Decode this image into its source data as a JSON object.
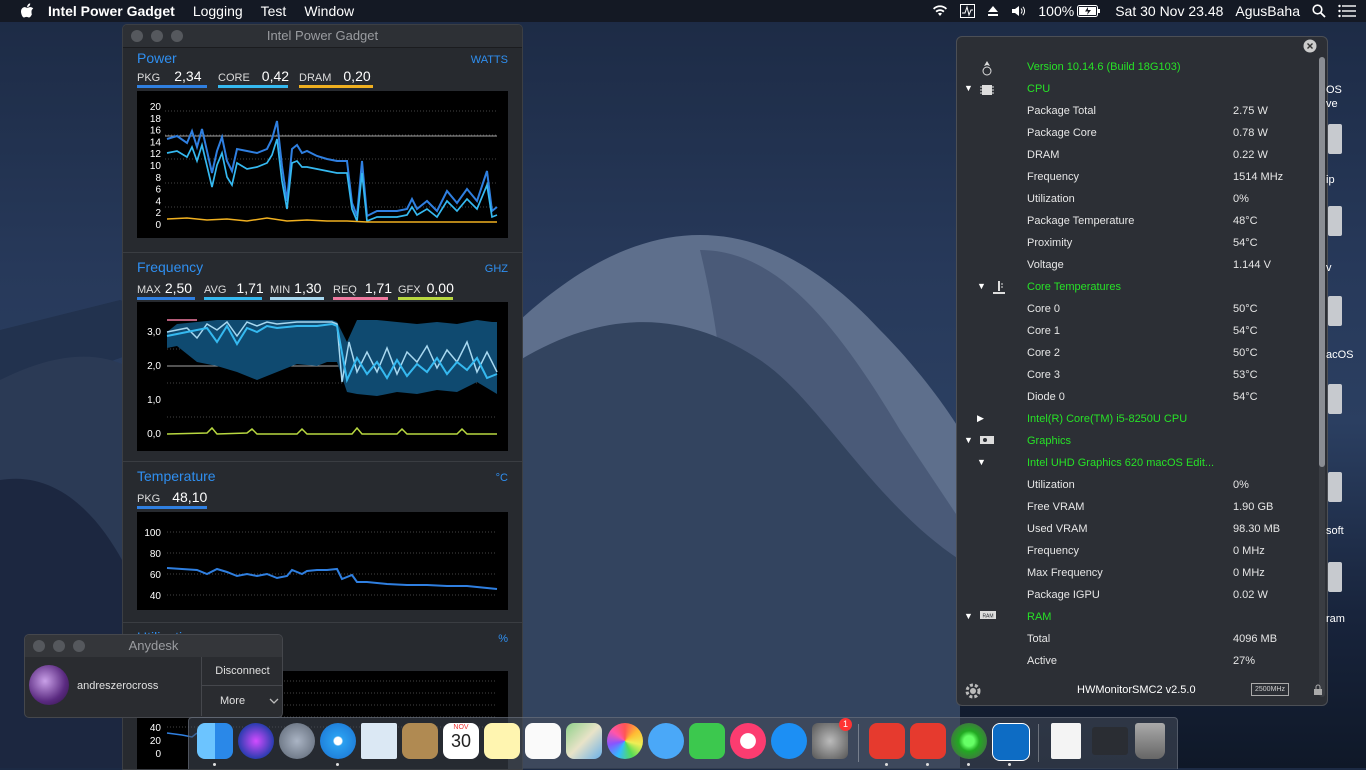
{
  "menubar": {
    "app_name": "Intel Power Gadget",
    "menus": [
      "Logging",
      "Test",
      "Window"
    ],
    "battery": "100%",
    "datetime": "Sat 30 Nov  23.48",
    "user": "AgusBaha"
  },
  "ipg": {
    "window_title": "Intel Power Gadget",
    "power": {
      "title": "Power",
      "unit": "WATTS",
      "metrics": [
        {
          "label": "PKG",
          "value": "2,34",
          "color": "#2f7fe0"
        },
        {
          "label": "CORE",
          "value": "0,42",
          "color": "#35b9f0"
        },
        {
          "label": "DRAM",
          "value": "0,20",
          "color": "#f0b020"
        }
      ],
      "yticks": [
        "20",
        "18",
        "16",
        "14",
        "12",
        "10",
        "8",
        "6",
        "4",
        "2",
        "0"
      ]
    },
    "frequency": {
      "title": "Frequency",
      "unit": "GHZ",
      "metrics": [
        {
          "label": "MAX",
          "value": "2,50",
          "color": "#2f7fe0"
        },
        {
          "label": "AVG",
          "value": "1,71",
          "color": "#35b9f0"
        },
        {
          "label": "MIN",
          "value": "1,30",
          "color": "#a8d8f0"
        },
        {
          "label": "REQ",
          "value": "1,71",
          "color": "#f07aa0"
        },
        {
          "label": "GFX",
          "value": "0,00",
          "color": "#b8d840"
        }
      ],
      "yticks": [
        "3,0",
        "2,0",
        "1,0",
        "0,0"
      ]
    },
    "temperature": {
      "title": "Temperature",
      "unit": "°C",
      "metrics": [
        {
          "label": "PKG",
          "value": "48,10",
          "color": "#2f7fe0"
        }
      ],
      "yticks": [
        "100",
        "80",
        "60",
        "40"
      ]
    },
    "utilization": {
      "title": "Utilization",
      "unit": "%",
      "yticks": [
        "40",
        "20",
        "0"
      ]
    }
  },
  "anydesk": {
    "title": "Anydesk",
    "username": "andreszerocross",
    "disconnect_label": "Disconnect",
    "more_label": "More"
  },
  "hwm": {
    "version": "Version 10.14.6 (Build 18G103)",
    "rows": [
      {
        "arrow": "▼",
        "icon": "cpu-icon",
        "label": "CPU",
        "value": "",
        "green": true
      },
      {
        "arrow": "",
        "icon": "",
        "label": "Package Total",
        "value": "2.75 W",
        "green": false
      },
      {
        "arrow": "",
        "icon": "",
        "label": "Package Core",
        "value": "0.78 W",
        "green": false
      },
      {
        "arrow": "",
        "icon": "",
        "label": "DRAM",
        "value": "0.22 W",
        "green": false
      },
      {
        "arrow": "",
        "icon": "",
        "label": "Frequency",
        "value": "1514 MHz",
        "green": false
      },
      {
        "arrow": "",
        "icon": "",
        "label": "Utilization",
        "value": "0%",
        "green": false
      },
      {
        "arrow": "",
        "icon": "",
        "label": "Package Temperature",
        "value": "48°C",
        "green": false
      },
      {
        "arrow": "",
        "icon": "",
        "label": "Proximity",
        "value": "54°C",
        "green": false
      },
      {
        "arrow": "",
        "icon": "",
        "label": "Voltage",
        "value": "1.144 V",
        "green": false
      },
      {
        "arrow": "▼",
        "icon": "thermometer-icon",
        "label": "Core Temperatures",
        "value": "",
        "green": true,
        "indent": true
      },
      {
        "arrow": "",
        "icon": "",
        "label": "Core 0",
        "value": "50°C",
        "green": false
      },
      {
        "arrow": "",
        "icon": "",
        "label": "Core 1",
        "value": "54°C",
        "green": false
      },
      {
        "arrow": "",
        "icon": "",
        "label": "Core 2",
        "value": "50°C",
        "green": false
      },
      {
        "arrow": "",
        "icon": "",
        "label": "Core 3",
        "value": "53°C",
        "green": false
      },
      {
        "arrow": "",
        "icon": "",
        "label": "Diode 0",
        "value": "54°C",
        "green": false
      },
      {
        "arrow": "▶",
        "icon": "",
        "label": "Intel(R) Core(TM) i5-8250U CPU",
        "value": "",
        "green": true,
        "indent": true
      },
      {
        "arrow": "▼",
        "icon": "gpu-icon",
        "label": "Graphics",
        "value": "",
        "green": true
      },
      {
        "arrow": "▼",
        "icon": "",
        "label": "Intel UHD Graphics 620 macOS Edit...",
        "value": "",
        "green": true,
        "indent": true
      },
      {
        "arrow": "",
        "icon": "",
        "label": "Utilization",
        "value": "0%",
        "green": false
      },
      {
        "arrow": "",
        "icon": "",
        "label": "Free VRAM",
        "value": "1.90 GB",
        "green": false
      },
      {
        "arrow": "",
        "icon": "",
        "label": "Used VRAM",
        "value": "98.30 MB",
        "green": false
      },
      {
        "arrow": "",
        "icon": "",
        "label": "Frequency",
        "value": "0 MHz",
        "green": false
      },
      {
        "arrow": "",
        "icon": "",
        "label": "Max Frequency",
        "value": "0 MHz",
        "green": false
      },
      {
        "arrow": "",
        "icon": "",
        "label": "Package IGPU",
        "value": "0.02 W",
        "green": false
      },
      {
        "arrow": "▼",
        "icon": "ram-icon",
        "label": "RAM",
        "value": "",
        "green": true
      },
      {
        "arrow": "",
        "icon": "",
        "label": "Total",
        "value": "4096 MB",
        "green": false
      },
      {
        "arrow": "",
        "icon": "",
        "label": "Active",
        "value": "27%",
        "green": false
      }
    ],
    "footer": "HWMonitorSMC2 v2.5.0",
    "ram_badge": "2500MHz"
  },
  "desktop_labels": [
    "OS",
    "ve",
    "ip",
    "v",
    "acOS",
    "soft",
    "ram"
  ],
  "dock": {
    "calendar_month": "NOV",
    "calendar_day": "30",
    "badge": "1",
    "apps": [
      "finder",
      "siri",
      "launchpad",
      "safari",
      "mail",
      "contacts",
      "calendar",
      "notes",
      "reminders",
      "maps",
      "photos",
      "messages",
      "facetime",
      "itunes",
      "app-store",
      "system-preferences",
      "anydesk",
      "anydesk-2",
      "hwmonitor",
      "intel-power-gadget",
      "document",
      "terminal",
      "trash"
    ]
  }
}
